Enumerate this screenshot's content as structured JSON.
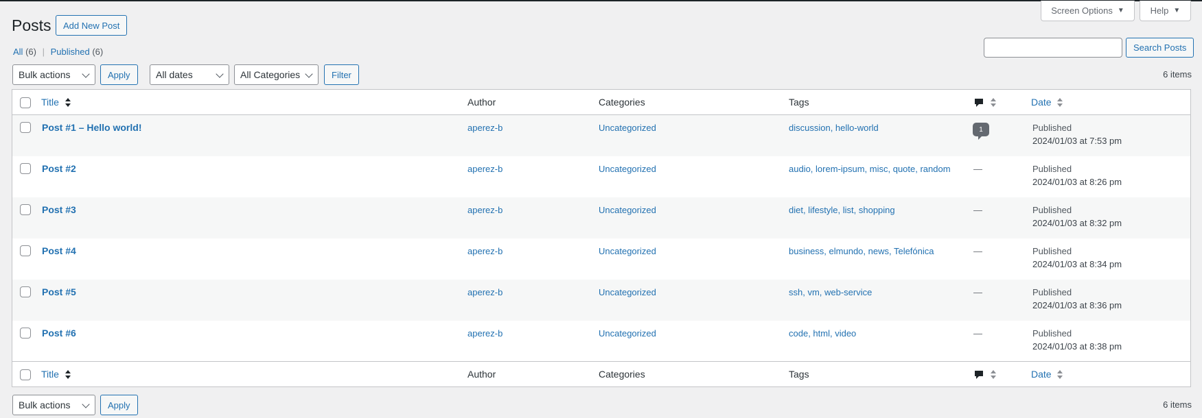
{
  "screen_meta": {
    "screen_options": "Screen Options",
    "help": "Help"
  },
  "page": {
    "title": "Posts",
    "add_new": "Add New Post"
  },
  "views": [
    {
      "label": "All",
      "count": "(6)"
    },
    {
      "label": "Published",
      "count": "(6)"
    }
  ],
  "views_separator": "|",
  "search": {
    "value": "",
    "button": "Search Posts"
  },
  "filters": {
    "bulk_actions": "Bulk actions",
    "apply": "Apply",
    "dates": "All dates",
    "categories": "All Categories",
    "filter": "Filter"
  },
  "items_count": "6 items",
  "columns": {
    "title": "Title",
    "author": "Author",
    "categories": "Categories",
    "tags": "Tags",
    "date": "Date"
  },
  "posts": [
    {
      "title": "Post #1 – Hello world!",
      "author": "aperez-b",
      "category": "Uncategorized",
      "tags": "discussion, hello-world",
      "comments": "1",
      "status": "Published",
      "date": "2024/01/03 at 7:53 pm"
    },
    {
      "title": "Post #2",
      "author": "aperez-b",
      "category": "Uncategorized",
      "tags": "audio, lorem-ipsum, misc, quote, random",
      "comments": "—",
      "status": "Published",
      "date": "2024/01/03 at 8:26 pm"
    },
    {
      "title": "Post #3",
      "author": "aperez-b",
      "category": "Uncategorized",
      "tags": "diet, lifestyle, list, shopping",
      "comments": "—",
      "status": "Published",
      "date": "2024/01/03 at 8:32 pm"
    },
    {
      "title": "Post #4",
      "author": "aperez-b",
      "category": "Uncategorized",
      "tags": "business, elmundo, news, Telefónica",
      "comments": "—",
      "status": "Published",
      "date": "2024/01/03 at 8:34 pm"
    },
    {
      "title": "Post #5",
      "author": "aperez-b",
      "category": "Uncategorized",
      "tags": "ssh, vm, web-service",
      "comments": "—",
      "status": "Published",
      "date": "2024/01/03 at 8:36 pm"
    },
    {
      "title": "Post #6",
      "author": "aperez-b",
      "category": "Uncategorized",
      "tags": "code, html, video",
      "comments": "—",
      "status": "Published",
      "date": "2024/01/03 at 8:38 pm"
    }
  ],
  "colors": {
    "link": "#2271b1",
    "background": "#f0f0f1",
    "alt_row": "#f6f7f7",
    "border": "#c3c4c7"
  }
}
